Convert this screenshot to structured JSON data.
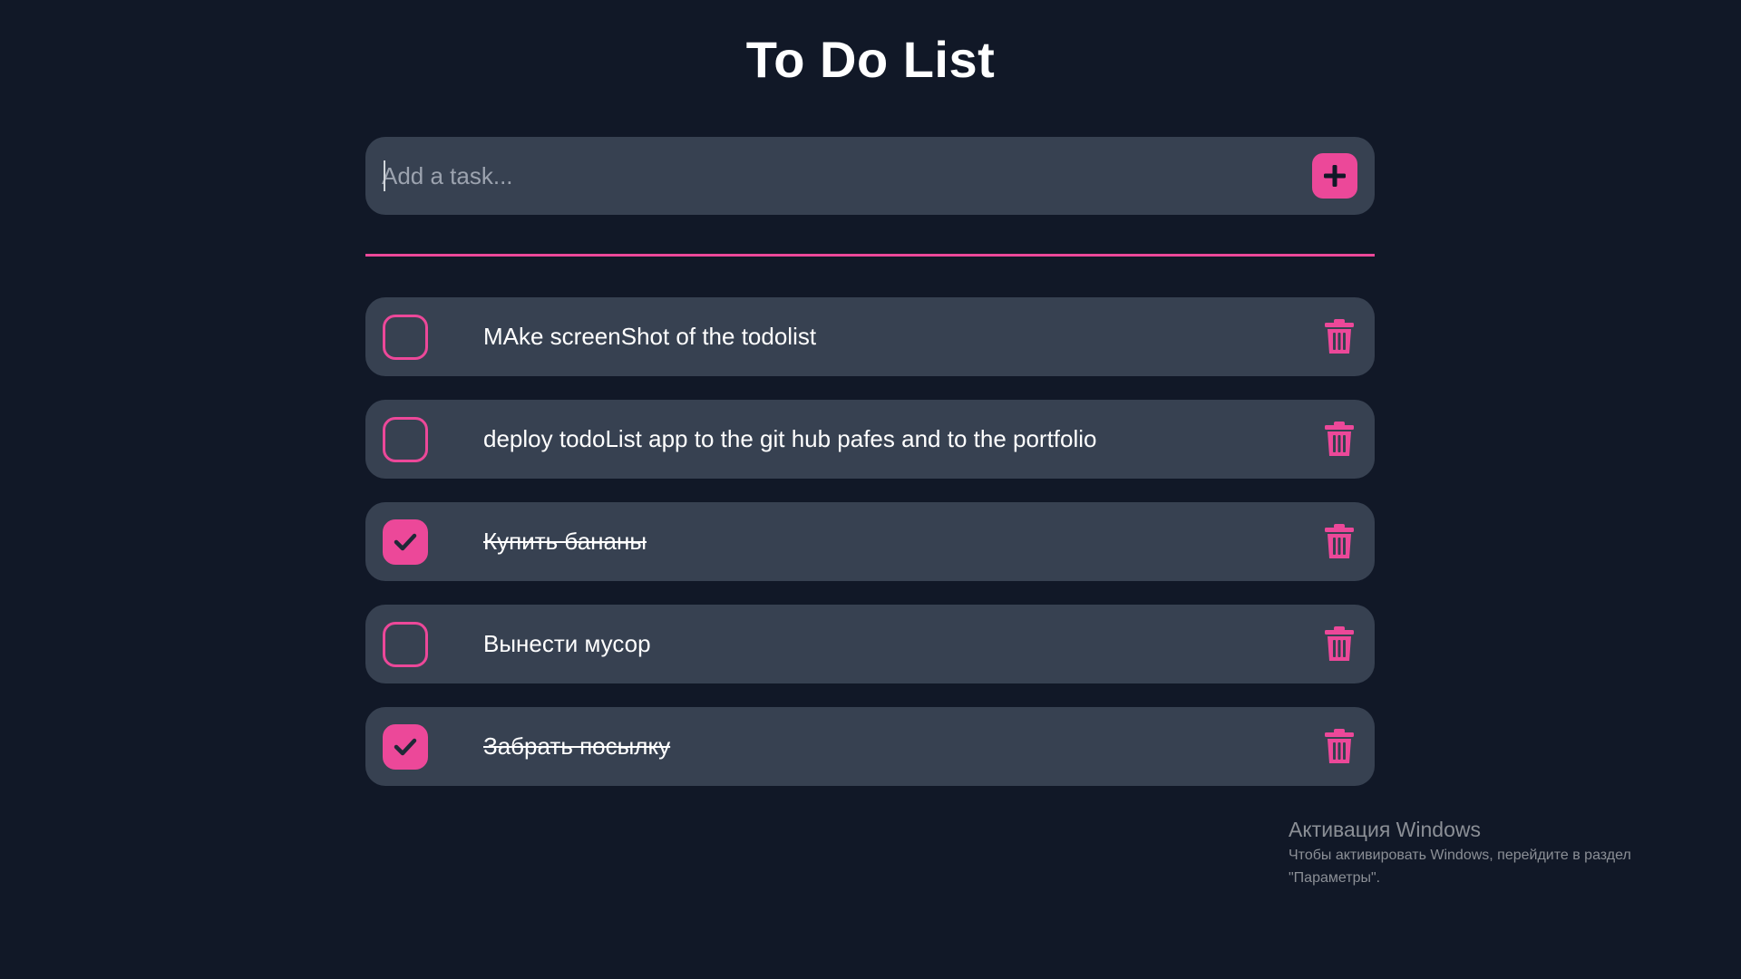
{
  "app": {
    "title": "To Do List"
  },
  "add_task": {
    "placeholder": "Add a task...",
    "button_icon": "plus-icon"
  },
  "tasks": [
    {
      "text": "MAke screenShot of the todolist",
      "completed": false
    },
    {
      "text": "deploy todoList app to the git hub pafes and to the portfolio",
      "completed": false
    },
    {
      "text": "Купить бананы",
      "completed": true
    },
    {
      "text": "Вынести мусор",
      "completed": false
    },
    {
      "text": "Забрать посылку",
      "completed": true
    }
  ],
  "watermark": {
    "title": "Активация Windows",
    "text": "Чтобы активировать Windows, перейдите в раздел \"Параметры\"."
  },
  "colors": {
    "background": "#111827",
    "card": "#374151",
    "accent": "#ec4899",
    "text": "#ffffff",
    "placeholder": "#9ca3af"
  }
}
